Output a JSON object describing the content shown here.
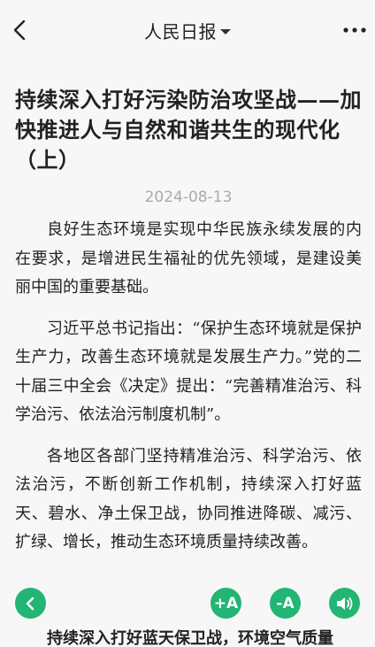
{
  "header": {
    "title": "人民日报"
  },
  "article": {
    "headline": "持续深入打好污染防治攻坚战——加快推进人与自然和谐共生的现代化（上）",
    "date": "2024-08-13",
    "paragraphs": [
      "良好生态环境是实现中华民族永续发展的内在要求，是增进民生福祉的优先领域，是建设美丽中国的重要基础。",
      "习近平总书记指出：“保护生态环境就是保护生产力，改善生态环境就是发展生产力。”党的二十届三中全会《决定》提出：“完善精准治污、科学治污、依法治污制度机制”。",
      "各地区各部门坚持精准治污、科学治污、依法治污，不断创新工作机制，持续深入打好蓝天、碧水、净土保卫战，协同推进降碳、减污、扩绿、增长，推动生态环境质量持续改善。"
    ],
    "partial_subheading": "持续深入打好蓝天保卫战，环境空气质量"
  },
  "toolbar": {
    "font_increase_label": "+A",
    "font_decrease_label": "-A"
  },
  "colors": {
    "accent": "#22b573",
    "date_text": "#aaaaaa",
    "background": "#f7f7f7"
  },
  "icons": {
    "back": "chevron-left-icon",
    "more": "more-horizontal-icon",
    "dropdown": "caret-down-icon",
    "float_back": "chevron-left-circle-icon",
    "speaker": "speaker-icon"
  }
}
